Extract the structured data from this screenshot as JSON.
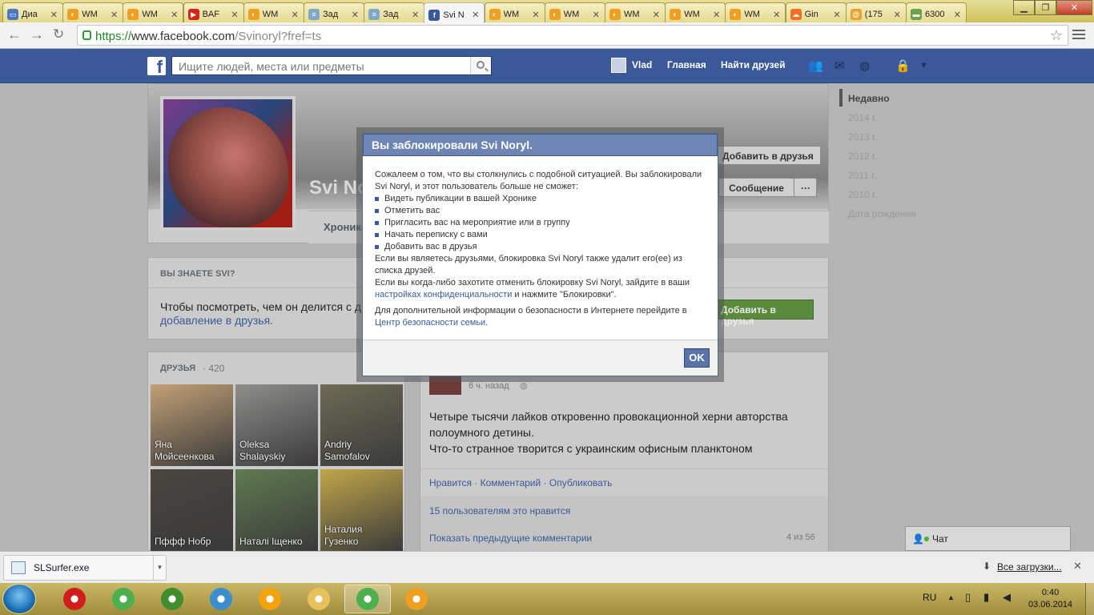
{
  "browser": {
    "tabs": [
      {
        "title": "Диа",
        "icon": "chat-icon",
        "color": "#4c76c0",
        "glyph": "▭"
      },
      {
        "title": "WM",
        "icon": "wmr-icon",
        "color": "#f0a020",
        "glyph": "◐"
      },
      {
        "title": "WM",
        "icon": "wmr-icon",
        "color": "#f0a020",
        "glyph": "◐"
      },
      {
        "title": "BAF",
        "icon": "youtube-icon",
        "color": "#d62417",
        "glyph": "▶"
      },
      {
        "title": "WM",
        "icon": "wmr-icon",
        "color": "#f0a020",
        "glyph": "◐"
      },
      {
        "title": "Зад",
        "icon": "task-icon",
        "color": "#7fa8c9",
        "glyph": "≡"
      },
      {
        "title": "Зад",
        "icon": "doc-icon",
        "color": "#7fa8c9",
        "glyph": "≡"
      },
      {
        "title": "Svi N",
        "icon": "facebook-icon",
        "color": "#3b5998",
        "glyph": "f"
      },
      {
        "title": "WM",
        "icon": "wmr-icon",
        "color": "#f0a020",
        "glyph": "◐"
      },
      {
        "title": "WM",
        "icon": "wmr-icon",
        "color": "#f0a020",
        "glyph": "◐"
      },
      {
        "title": "WM",
        "icon": "wmr-icon",
        "color": "#f0a020",
        "glyph": "◐"
      },
      {
        "title": "WM",
        "icon": "wmr-icon",
        "color": "#f0a020",
        "glyph": "◐"
      },
      {
        "title": "WM",
        "icon": "wmr-icon",
        "color": "#f0a020",
        "glyph": "◐"
      },
      {
        "title": "Gin",
        "icon": "soundcloud-icon",
        "color": "#f26f23",
        "glyph": "☁"
      },
      {
        "title": "(175",
        "icon": "mail-icon",
        "color": "#e6a42e",
        "glyph": "@"
      },
      {
        "title": "6300",
        "icon": "money-icon",
        "color": "#6fa34a",
        "glyph": "▬"
      }
    ],
    "active_tab": 7,
    "url": {
      "scheme": "https://",
      "host": "www.facebook.com",
      "path": "/Svinoryl?fref=ts"
    }
  },
  "fb": {
    "search_placeholder": "Ищите людей, места или предметы",
    "user": "Vlad",
    "home": "Главная",
    "find_friends": "Найти друзей",
    "brand": "#3b5998"
  },
  "profile": {
    "name": "Svi No",
    "add_friend": "Добавить в друзья",
    "message": "Сообщение",
    "more": "···",
    "timeline_tab": "Хроника"
  },
  "know": {
    "header": "ВЫ ЗНАЕТЕ SVI?",
    "text": "Чтобы посмотреть, чем он делится с д",
    "link": "добавление в друзья.",
    "add_button": "Добавить в друзья"
  },
  "friends": {
    "label": "ДРУЗЬЯ",
    "count": "· 420",
    "items": [
      {
        "name": "Яна Мойсеенкова",
        "color": "#c2a076"
      },
      {
        "name": "Oleksa Shalayskiy",
        "color": "#8d8f8c"
      },
      {
        "name": "Andriy Samofalov",
        "color": "#6e6a55"
      },
      {
        "name": "Пффф Нобр",
        "color": "#4a4540"
      },
      {
        "name": "Наталі Іщенко",
        "color": "#5f7a50"
      },
      {
        "name": "Наталия Гузенко",
        "color": "#c1a64a"
      }
    ]
  },
  "post": {
    "time": "6 ч. назад",
    "line1": "Четыре тысячи лайков откровенно провокационной херни авторства",
    "line2": "полоумного детины.",
    "line3": "Что-то странное творится с украинским офисным планктоном",
    "actions": "Нравится · Комментарий · Опубликовать",
    "likes": "15 пользователям это нравится",
    "prev_comments": "Показать предыдущие комментарии",
    "count": "4 из 56"
  },
  "timeline": {
    "items": [
      "Недавно",
      "2014 г.",
      "2013 г.",
      "2012 г.",
      "2011 г.",
      "2010 г.",
      "Дата рождения"
    ]
  },
  "dialog": {
    "title": "Вы заблокировали Svi Noryl.",
    "intro": "Сожалеем о том, что вы столкнулись с подобной ситуацией. Вы заблокировали Svi Noryl, и этот пользователь больше не сможет:",
    "bullets": [
      "Видеть публикации в вашей Хронике",
      "Отметить вас",
      "Пригласить вас на мероприятие или в группу",
      "Начать переписку с вами",
      "Добавить вас в друзья"
    ],
    "p2": "Если вы являетесь друзьями, блокировка Svi Noryl также удалит его(ее) из списка друзей.",
    "p3a": "Если вы когда-либо захотите отменить блокировку Svi Noryl, зайдите в ваши ",
    "p3link": "настройках конфиденциальности",
    "p3b": " и нажмите \"Блокировки\".",
    "p4a": "Для дополнительной информации о безопасности в Интернете перейдите в ",
    "p4link": "Центр безопасности семьи",
    "p4b": ".",
    "ok": "OK"
  },
  "chat": {
    "label": "Чат"
  },
  "downloads": {
    "file": "SLSurfer.exe",
    "all": "Все загрузки..."
  },
  "taskbar": {
    "apps": [
      {
        "name": "opera-icon",
        "color": "#d31c1c"
      },
      {
        "name": "chrome-icon",
        "color": "#4caf50"
      },
      {
        "name": "utorrent-icon",
        "color": "#3f8d2c"
      },
      {
        "name": "video-icon",
        "color": "#3a8fcf"
      },
      {
        "name": "aimp-icon",
        "color": "#f5a30c"
      },
      {
        "name": "folder-icon",
        "color": "#e8c15a"
      },
      {
        "name": "chrome-icon",
        "color": "#4caf50"
      },
      {
        "name": "wmr-icon",
        "color": "#f0a020"
      }
    ],
    "active_app": 6,
    "lang": "RU",
    "time": "0:40",
    "date": "03.06.2014"
  }
}
